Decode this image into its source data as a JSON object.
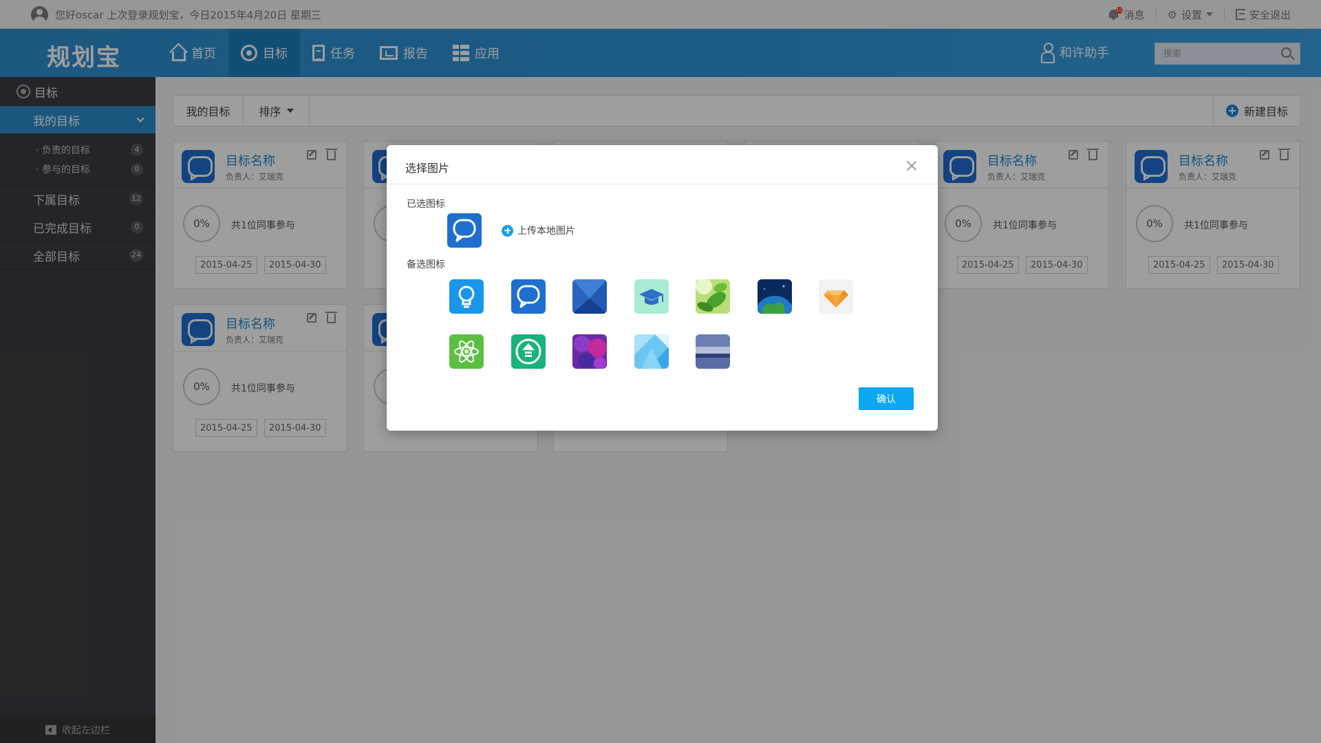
{
  "topbar": {
    "greeting": "您好oscar 上次登录规划宝，今日2015年4月20日 星期三",
    "message_label": "消息",
    "message_badge": "10",
    "settings_label": "设置",
    "logout_label": "安全退出"
  },
  "header": {
    "logo": "规划宝",
    "nav": [
      {
        "label": "首页",
        "icon": "home-icon"
      },
      {
        "label": "目标",
        "icon": "target-icon",
        "active": true
      },
      {
        "label": "任务",
        "icon": "task-icon"
      },
      {
        "label": "报告",
        "icon": "report-icon"
      },
      {
        "label": "应用",
        "icon": "app-grid-icon"
      }
    ],
    "assistant_label": "和许助手",
    "search_placeholder": "搜索"
  },
  "sidebar": {
    "section_title": "目标",
    "active_item": "我的目标",
    "sub_items": [
      {
        "label": "负责的目标",
        "count": "4"
      },
      {
        "label": "参与的目标",
        "count": "0"
      }
    ],
    "items": [
      {
        "label": "下属目标",
        "count": "12"
      },
      {
        "label": "已完成目标",
        "count": "0"
      },
      {
        "label": "全部目标",
        "count": "24"
      }
    ],
    "collapse_label": "收起左边栏"
  },
  "toolbar": {
    "my_goals": "我的目标",
    "sort": "排序",
    "new_goal": "新建目标"
  },
  "cards": [
    {
      "title": "目标名称",
      "owner": "负责人：艾瑞克",
      "progress": "0%",
      "participants": "共1位同事参与",
      "start": "2015-04-25",
      "end": "2015-04-30"
    },
    {
      "title": "目标名称",
      "owner": "负责人：艾瑞克",
      "progress": "0%",
      "participants": "共1位同事参与",
      "start": "2015-04-25",
      "end": "2015-04-30"
    },
    {
      "title": "目标名称",
      "owner": "负责人：艾瑞克",
      "progress": "0%",
      "participants": "共1位同事参与",
      "start": "2015-04-25",
      "end": "2015-04-30"
    },
    {
      "title": "目标名称",
      "owner": "负责人：艾瑞克",
      "progress": "0%",
      "participants": "共1位同事参与",
      "start": "2015-04-25",
      "end": "2015-04-30"
    }
  ],
  "modal": {
    "title": "选择图片",
    "selected_label": "已选图标",
    "upload_label": "上传本地图片",
    "options_label": "备选图标",
    "confirm_label": "确认",
    "icons": [
      "bulb-icon",
      "chat-bubble-icon",
      "blue-polygon-icon",
      "graduation-cap-icon",
      "green-leaf-icon",
      "earth-icon",
      "diamond-icon",
      "atom-icon",
      "upload-arrow-icon",
      "purple-pattern-icon",
      "light-blue-pattern-icon",
      "landscape-icon"
    ]
  }
}
